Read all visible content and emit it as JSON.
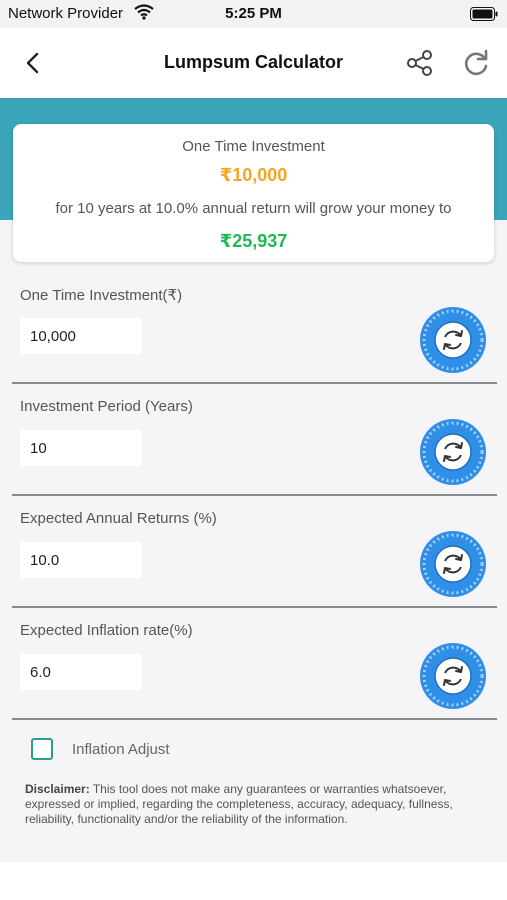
{
  "status_bar": {
    "carrier": "Network Provider",
    "time": "5:25 PM"
  },
  "header": {
    "title": "Lumpsum Calculator"
  },
  "summary": {
    "investment_label": "One Time Investment",
    "investment_amount": "₹10,000",
    "description": "for 10 years at 10.0% annual return will grow your money to",
    "result_amount": "₹25,937"
  },
  "fields": [
    {
      "label": "One Time Investment(₹)",
      "value": "10,000"
    },
    {
      "label": "Investment Period (Years)",
      "value": "10"
    },
    {
      "label": "Expected Annual Returns (%)",
      "value": "10.0"
    },
    {
      "label": "Expected Inflation rate(%)",
      "value": "6.0"
    }
  ],
  "inflation_adjust": {
    "label": "Inflation Adjust",
    "checked": false
  },
  "disclaimer": {
    "title": "Disclaimer:",
    "text": " This tool does not make any guarantees or warranties whatsoever, expressed or implied, regarding the completeness, accuracy, adequacy, fullness, reliability, functionality and/or the reliability of the information."
  },
  "colors": {
    "accent_teal": "#3aa5b8",
    "dial_blue": "#2f8ee6",
    "amount_orange": "#f5a623",
    "result_green": "#1db954",
    "checkbox_green": "#2a9d8f"
  }
}
